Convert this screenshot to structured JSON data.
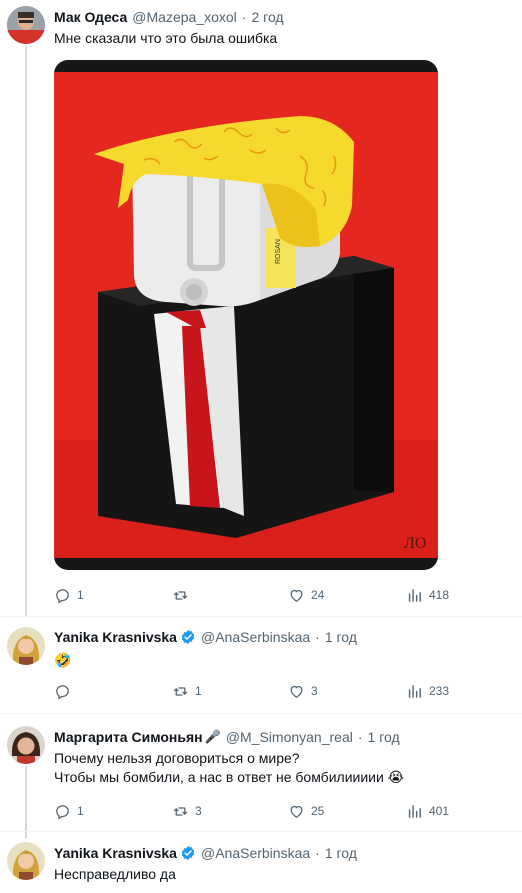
{
  "tweets": [
    {
      "name": "Мак Одеса",
      "handle": "@Mazepa_xoxol",
      "sep": "·",
      "time": "2 год",
      "text": "Мне сказали что это была ошибка",
      "replies": "1",
      "retweets": "",
      "likes": "24",
      "views": "418"
    },
    {
      "name": "Yanika Krasnivska",
      "handle": "@AnaSerbinskaa",
      "sep": "·",
      "time": "1 год",
      "text": "🤣",
      "replies": "",
      "retweets": "1",
      "likes": "3",
      "views": "233"
    },
    {
      "name": "Маргарита Симоньян",
      "handle": "@M_Simonyan_real",
      "sep": "·",
      "time": "1 год",
      "text_line1": "Почему нельзя договориться о мире?",
      "text_line2": "Чтобы мы бомбили, а нас в ответ не бомбилиииии 😭",
      "replies": "1",
      "retweets": "3",
      "likes": "25",
      "views": "401"
    },
    {
      "name": "Yanika Krasnivska",
      "handle": "@AnaSerbinskaa",
      "sep": "·",
      "time": "1 год",
      "text": "Несправедливо да"
    }
  ],
  "image": {
    "signature": "ЛО",
    "label_text": "ROSAN"
  },
  "colors": {
    "verified": "#1d9bf0",
    "muted": "#536471",
    "thread_line": "#cfd9de",
    "photo_background": "#e5281f"
  },
  "icons": [
    "reply-icon",
    "retweet-icon",
    "like-icon",
    "views-icon",
    "verified-badge-icon",
    "microphone-emoji-icon"
  ]
}
